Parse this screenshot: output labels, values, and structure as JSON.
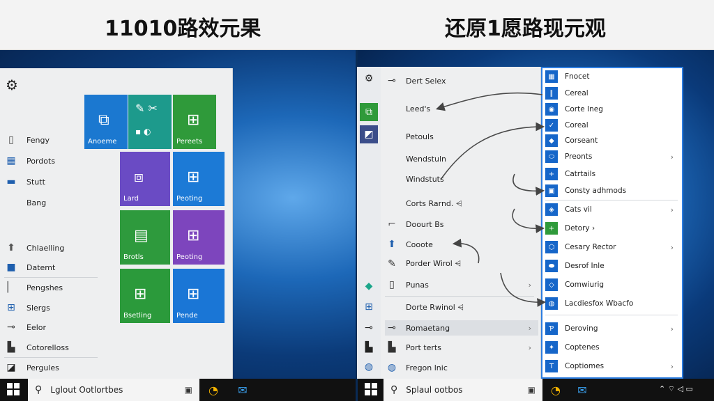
{
  "titles": {
    "left": "11010路效元果",
    "right": "还原1愿路现元观"
  },
  "left_menu": {
    "gear_icon": "gear-icon",
    "items": [
      {
        "label": "Fengy",
        "icon": "document-icon"
      },
      {
        "label": "Pordots",
        "icon": "grid-icon"
      },
      {
        "label": "Stutt",
        "icon": "landscape-icon"
      },
      {
        "label": "Bang",
        "icon": "blank-icon"
      },
      {
        "label": "Chlaelling",
        "icon": "arrow-up-icon"
      },
      {
        "label": "Datemt",
        "icon": "blue-square-icon"
      },
      {
        "label": "Pengshes",
        "icon": "bar-icon"
      },
      {
        "label": "Slergs",
        "icon": "grid-icon"
      },
      {
        "label": "Eelor",
        "icon": "pulse-icon"
      },
      {
        "label": "Cotorelloss",
        "icon": "box-icon"
      },
      {
        "label": "Pergules",
        "icon": "dark-square-icon"
      }
    ],
    "tiles": [
      {
        "label": "Anoeme",
        "color": "#1b78d0"
      },
      {
        "label": "",
        "color": "#1d9a8c"
      },
      {
        "label": "Pereets",
        "color": "#2f9a3a"
      },
      {
        "label": "Lard",
        "color": "#6a4bc4"
      },
      {
        "label": "Peoting",
        "color": "#1c7ad6"
      },
      {
        "label": "Brotls",
        "color": "#2e9a3d"
      },
      {
        "label": "Peoting",
        "color": "#7d45bd"
      },
      {
        "label": "Bsetling",
        "color": "#2b9a3b"
      },
      {
        "label": "Pende",
        "color": "#1a76d6"
      }
    ]
  },
  "right_rail": [
    "gear-icon",
    "app-icon",
    "photo-icon",
    "leaf-icon",
    "grid-icon",
    "pulse-icon",
    "box-icon",
    "globe-icon"
  ],
  "right_menu": {
    "items": [
      {
        "label": "Dert Selex",
        "icon": "pulse-icon",
        "chevron": ""
      },
      {
        "label": "Leed's",
        "icon": "blank-icon",
        "chevron": ""
      },
      {
        "label": "Petouls",
        "icon": "blank-icon",
        "chevron": ""
      },
      {
        "label": "Wendstuln",
        "icon": "blank-icon",
        "chevron": ""
      },
      {
        "label": "Windstuts",
        "icon": "blank-icon",
        "chevron": ""
      },
      {
        "label": "Corts Rarnd. ⩤",
        "icon": "blank-icon",
        "chevron": ""
      },
      {
        "label": "Doourt Bs",
        "icon": "crop-icon",
        "chevron": ""
      },
      {
        "label": "Cooote",
        "icon": "arrow-up-icon",
        "chevron": ""
      },
      {
        "label": "Porder Wirol ⩤",
        "icon": "wrench-icon",
        "chevron": ""
      },
      {
        "label": "Punas",
        "icon": "doc-icon",
        "chevron": "›"
      },
      {
        "label": "Dorte Rwinol ⩤",
        "icon": "blank-icon",
        "chevron": ""
      },
      {
        "label": "Romaetang",
        "icon": "pulse-icon",
        "chevron": "›"
      },
      {
        "label": "Port terts",
        "icon": "box-icon",
        "chevron": "›"
      },
      {
        "label": "Fregon lnic",
        "icon": "globe-icon",
        "chevron": ""
      }
    ]
  },
  "submenu": {
    "items": [
      {
        "label": "Fnocet",
        "icon": "▦",
        "chevron": ""
      },
      {
        "label": "Cereal",
        "icon": "∥",
        "chevron": ""
      },
      {
        "label": "Corte Ineg",
        "icon": "◉",
        "chevron": ""
      },
      {
        "label": "Coreal",
        "icon": "✓",
        "chevron": ""
      },
      {
        "label": "Corseant",
        "icon": "◆",
        "chevron": ""
      },
      {
        "label": "Preonts",
        "icon": "⬭",
        "chevron": "›"
      },
      {
        "label": "Catrtails",
        "icon": "+",
        "chevron": ""
      },
      {
        "label": "Consty adhmods",
        "icon": "▣",
        "chevron": ""
      },
      {
        "label": "Cats vil",
        "icon": "◈",
        "chevron": "›"
      },
      {
        "label": "Detory ›",
        "icon": "+",
        "chevron": ""
      },
      {
        "label": "Cesary Rector",
        "icon": "⬡",
        "chevron": "›"
      },
      {
        "label": "Desrof Inle",
        "icon": "⬬",
        "chevron": ""
      },
      {
        "label": "Comwiurig",
        "icon": "◇",
        "chevron": ""
      },
      {
        "label": "Lacdiesfox Wbacfo",
        "icon": "◍",
        "chevron": ""
      },
      {
        "label": "Deroving",
        "icon": "Ƥ",
        "chevron": "›"
      },
      {
        "label": "Coptenes",
        "icon": "✦",
        "chevron": ""
      },
      {
        "label": "Coptiomes",
        "icon": "T",
        "chevron": "›"
      }
    ]
  },
  "taskbar": {
    "left_search": "Lglout Ootlortbes",
    "right_search": "Splaul ootbos"
  },
  "colors": {
    "accent": "#2d7de0",
    "icon_blue": "#1666c9"
  }
}
